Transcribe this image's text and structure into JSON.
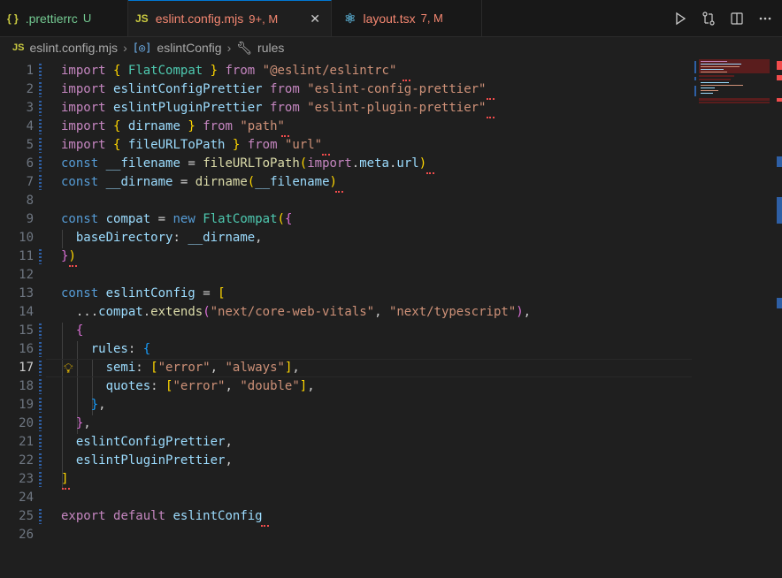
{
  "tabs": [
    {
      "icon": "{ }",
      "label": ".prettierrc",
      "status": "U",
      "active": false
    },
    {
      "icon": "JS",
      "label": "eslint.config.mjs",
      "status": "9+, M",
      "active": true
    },
    {
      "icon": "⚛",
      "label": "layout.tsx",
      "status": "7, M",
      "active": false
    }
  ],
  "breadcrumb": {
    "file_icon": "JS",
    "file": "eslint.config.mjs",
    "symbol": "eslintConfig",
    "property": "rules"
  },
  "editor": {
    "current_line": 17,
    "line_numbers": [
      "1",
      "2",
      "3",
      "4",
      "5",
      "6",
      "7",
      "8",
      "9",
      "10",
      "11",
      "12",
      "13",
      "14",
      "15",
      "16",
      "17",
      "18",
      "19",
      "20",
      "21",
      "22",
      "23",
      "24",
      "25",
      "26"
    ]
  },
  "colors": {
    "accent": "#0078d4",
    "error": "#f14c4c",
    "modified_tab": "#e2c08d"
  }
}
